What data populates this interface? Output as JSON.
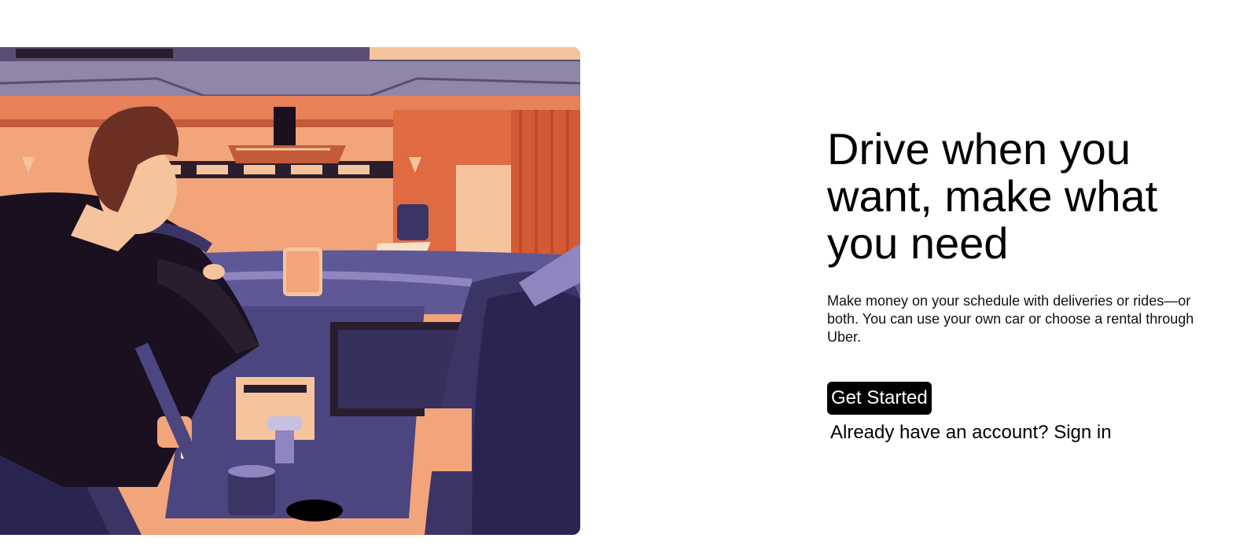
{
  "hero": {
    "image_name": "driver-illustration",
    "headline": "Drive when you want, make what you need",
    "description": "Make money on your schedule with deliveries or rides—or both. You can use your own car or choose a rental through Uber.",
    "cta_label": "Get Started",
    "signin_prompt": "Already have an account?",
    "signin_label": "Sign in"
  },
  "colors": {
    "background": "#ffffff",
    "button_bg": "#000000",
    "button_text": "#ffffff",
    "text": "#000000"
  }
}
